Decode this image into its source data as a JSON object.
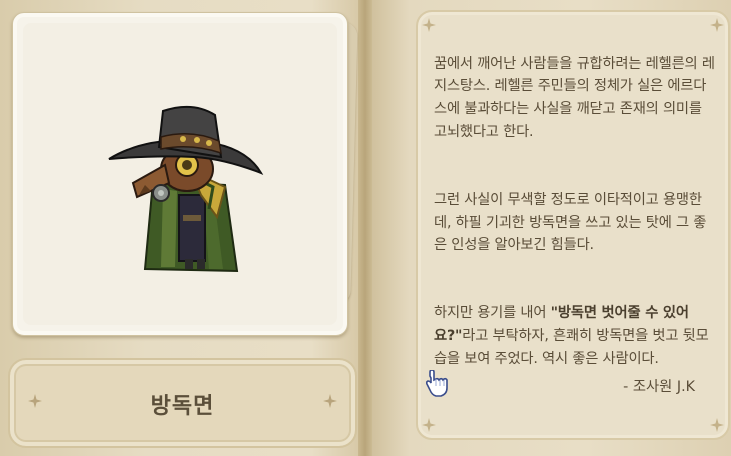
{
  "item": {
    "name": "방독면"
  },
  "description": {
    "para1": "꿈에서 깨어난 사람들을 규합하려는 레헬른의 레지스탕스. 레헬른 주민들의 정체가 실은 에르다스에 불과하다는 사실을 깨닫고 존재의 의미를 고뇌했다고 한다.",
    "para2": "그런 사실이 무색할 정도로 이타적이고 용맹한데, 하필 기괴한 방독면을 쓰고 있는 탓에 그 좋은 인성을 알아보긴 힘들다.",
    "para3_pre": "하지만 용기를 내어 ",
    "para3_bold": "\"방독면 벗어줄 수 있어요?\"",
    "para3_post": "라고 부탁하자, 흔쾌히 방독면을 벗고 뒷모습을 보여 주었다. 역시 좋은 사람이다.",
    "signature": "- 조사원 J.K"
  },
  "icons": {
    "portrait": "plague-doctor-character",
    "cursor": "pointing-hand-cursor",
    "ornaments": "sparkle-star-icon"
  },
  "colors": {
    "paper": "#e8dec6",
    "text": "#5a4d38",
    "coat": "#3f5a25",
    "hat": "#3b3a3a"
  }
}
